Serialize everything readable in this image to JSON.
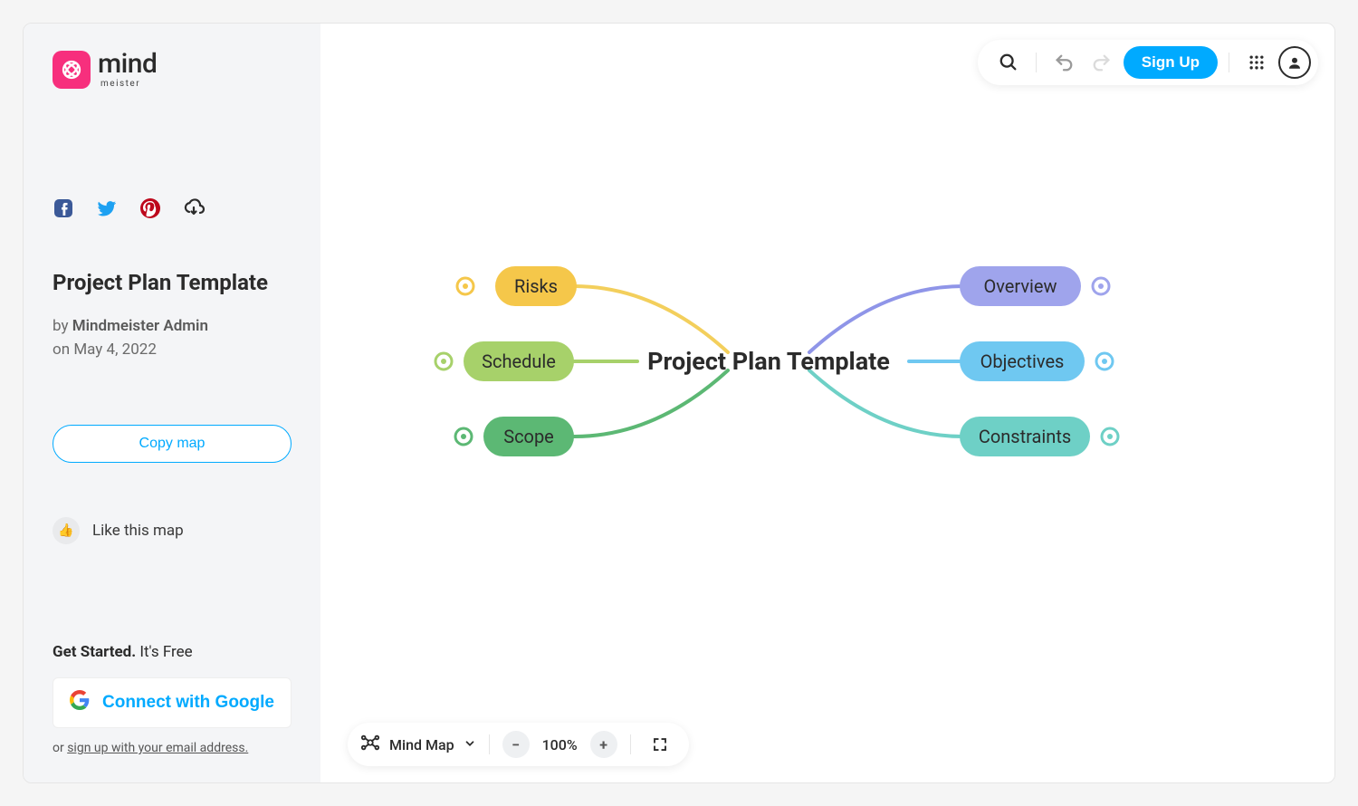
{
  "brand": {
    "name": "mind",
    "sub": "meister"
  },
  "sidebar": {
    "title": "Project Plan Template",
    "by_prefix": "by ",
    "author": "Mindmeister Admin",
    "date_prefix": "on ",
    "date": "May 4, 2022",
    "copy_label": "Copy map",
    "like_label": "Like this map",
    "getstarted_bold": "Get Started.",
    "getstarted_rest": " It's Free",
    "google_label": "Connect with Google",
    "or_prefix": "or ",
    "or_link": "sign up with your email address."
  },
  "toolbar": {
    "signup_label": "Sign Up"
  },
  "bottom": {
    "view_label": "Mind Map",
    "zoom_value": "100%"
  },
  "map": {
    "central": "Project Plan Template",
    "left": [
      {
        "label": "Risks",
        "color": "#f5c74a",
        "conn": "#f3cf5c"
      },
      {
        "label": "Schedule",
        "color": "#a7d16a",
        "conn": "#a7d16a"
      },
      {
        "label": "Scope",
        "color": "#5cb874",
        "conn": "#5cb874"
      }
    ],
    "right": [
      {
        "label": "Overview",
        "color": "#9fa4ec",
        "conn": "#8f95e8"
      },
      {
        "label": "Objectives",
        "color": "#6fc8f1",
        "conn": "#6fc8f1"
      },
      {
        "label": "Constraints",
        "color": "#6ed0c6",
        "conn": "#6ed0c6"
      }
    ]
  }
}
